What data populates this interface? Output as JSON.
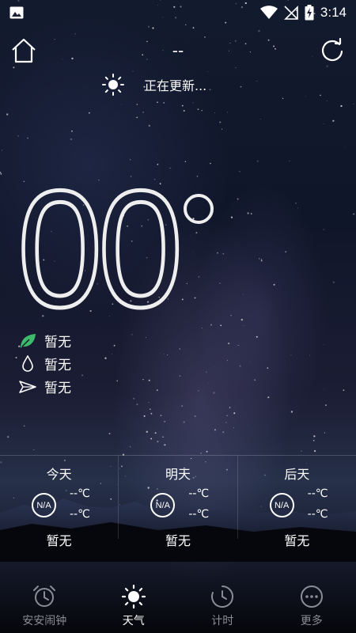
{
  "status_bar": {
    "time": "3:14"
  },
  "header": {
    "city": "--"
  },
  "update": {
    "text": "正在更新..."
  },
  "temperature": {
    "value": "00"
  },
  "details": [
    {
      "icon": "leaf-icon",
      "text": "暂无"
    },
    {
      "icon": "water-drop-icon",
      "text": "暂无"
    },
    {
      "icon": "paper-plane-icon",
      "text": "暂无"
    }
  ],
  "forecast": [
    {
      "day": "今天",
      "icon_text": "N/A",
      "high": "--℃",
      "low": "--℃",
      "desc": "暂无"
    },
    {
      "day": "明天",
      "icon_text": "N/A",
      "high": "--℃",
      "low": "--℃",
      "desc": "暂无"
    },
    {
      "day": "后天",
      "icon_text": "N/A",
      "high": "--℃",
      "low": "--℃",
      "desc": "暂无"
    }
  ],
  "tabs": [
    {
      "label": "安安闹钟",
      "icon": "alarm-clock-icon",
      "active": false
    },
    {
      "label": "天气",
      "icon": "sun-icon",
      "active": true
    },
    {
      "label": "计时",
      "icon": "timer-icon",
      "active": false
    },
    {
      "label": "更多",
      "icon": "more-icon",
      "active": false
    }
  ],
  "colors": {
    "leaf": "#3dbb6a",
    "tab_inactive": "#8a8d96",
    "tab_active": "#ffffff"
  }
}
